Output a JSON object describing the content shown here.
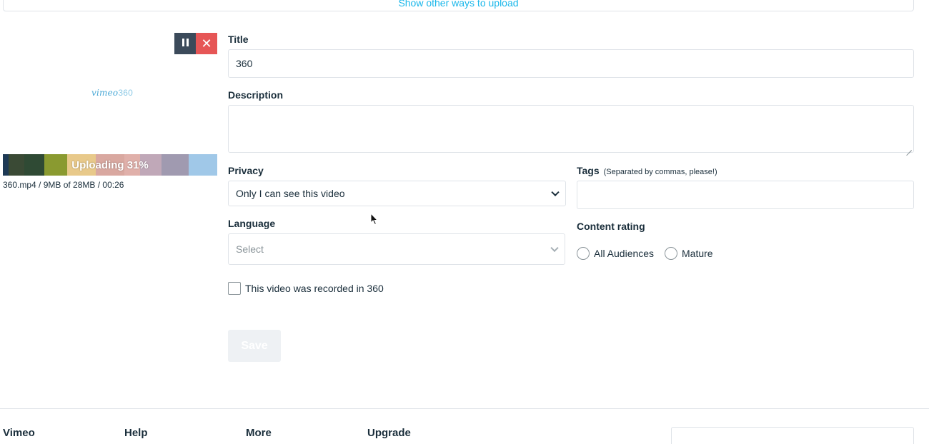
{
  "top_link": "Show other ways to upload",
  "upload": {
    "pause_icon": "pause-icon",
    "close_icon": "close-icon",
    "thumbnail_logo": "vimeo",
    "thumbnail_logo_num": "360",
    "progress_percent": 31,
    "status_label": "Uploading 31%",
    "file_info": "360.mp4 / 9MB of 28MB / 00:26",
    "thumbnail_strip_colors": [
      "#1e3a55",
      "#3a4a35",
      "#2f4a34",
      "#8a9a30",
      "#e8c98a",
      "#d9a8a0",
      "#e0b0aa",
      "#c0a8b8",
      "#a09ab0",
      "#a0c8e8"
    ]
  },
  "form": {
    "title_label": "Title",
    "title_value": "360",
    "description_label": "Description",
    "description_value": "",
    "privacy_label": "Privacy",
    "privacy_value": "Only I can see this video",
    "tags_label": "Tags",
    "tags_hint": "(Separated by commas, please!)",
    "tags_value": "",
    "language_label": "Language",
    "language_placeholder": "Select",
    "content_rating_label": "Content rating",
    "rating_options": [
      "All Audiences",
      "Mature"
    ],
    "recorded_360_label": "This video was recorded in 360",
    "save_label": "Save"
  },
  "footer": {
    "columns": [
      "Vimeo",
      "Help",
      "More",
      "Upgrade"
    ]
  },
  "colors": {
    "accent": "#1ab7ea",
    "text": "#1a2e3b",
    "pause_bg": "#3b4a5a",
    "close_bg": "#e65656",
    "border": "#dfe3e8"
  }
}
